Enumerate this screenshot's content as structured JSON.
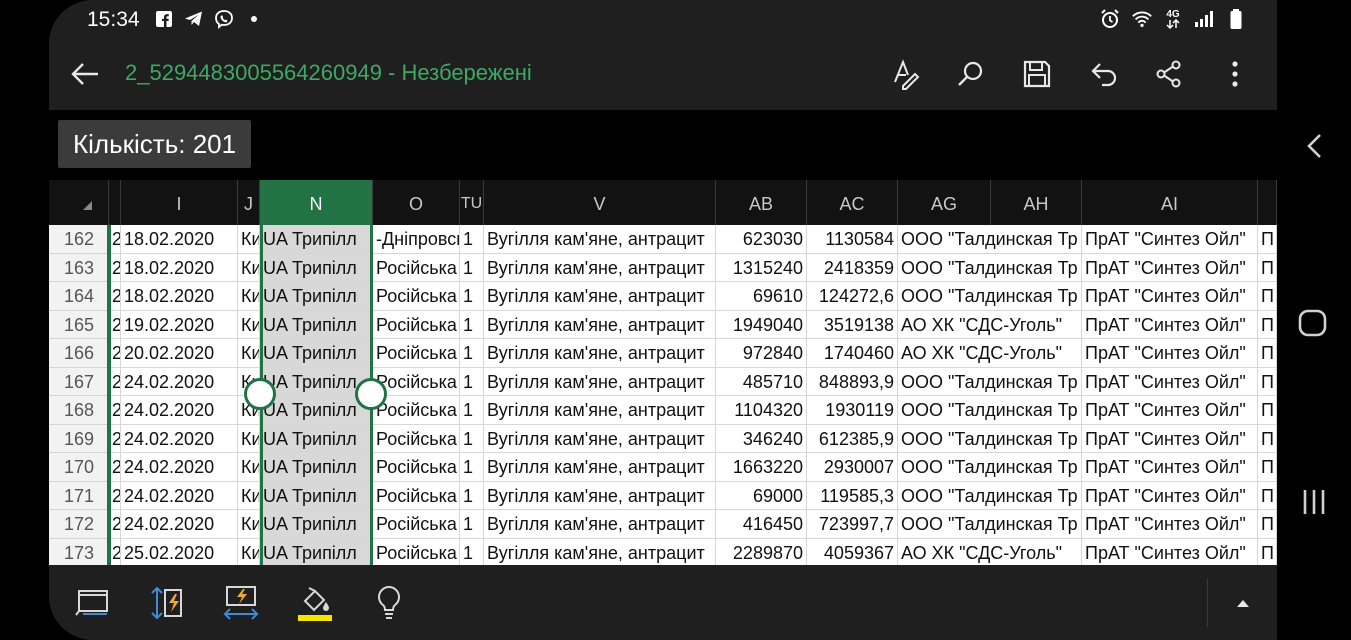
{
  "status_bar": {
    "time": "15:34",
    "icons": [
      "facebook-icon",
      "telegram-icon",
      "viber-icon",
      "notification-dot",
      "alarm-icon",
      "wifi-icon",
      "mobile-data-icon",
      "signal-icon",
      "battery-icon"
    ],
    "network_label": "4G"
  },
  "app_bar": {
    "title": "2_5294483005564260949 - Незбережені",
    "title_color": "#3fa862",
    "actions": [
      "draw-icon",
      "search-icon",
      "save-icon",
      "undo-icon",
      "share-icon",
      "more-icon"
    ]
  },
  "selection": {
    "count_label": "Кількість: 201",
    "selected_column": "N"
  },
  "columns": [
    "I",
    "J",
    "N",
    "O",
    "TU",
    "V",
    "AB",
    "AC",
    "AG",
    "AH",
    "AI"
  ],
  "rows": [
    {
      "n": "162",
      "h": "2",
      "i": "18.02.2020",
      "j": "Ки",
      "nval": "UA Трипілл",
      "o": "-Дніпровсь",
      "tu": "1",
      "v": "Вугілля кам'яне, антрацит",
      "ab": "623030",
      "ac": "1130584",
      "ag": "ООО \"Талдинская Тр",
      "ai": "ПрАТ \"Синтез Ойл\"",
      "last": "П"
    },
    {
      "n": "163",
      "h": "2",
      "i": "18.02.2020",
      "j": "Ки",
      "nval": "UA Трипілл",
      "o": "Російська Ф",
      "tu": "1",
      "v": "Вугілля кам'яне, антрацит",
      "ab": "1315240",
      "ac": "2418359",
      "ag": "ООО \"Талдинская Тр",
      "ai": "ПрАТ \"Синтез Ойл\"",
      "last": "П"
    },
    {
      "n": "164",
      "h": "2",
      "i": "18.02.2020",
      "j": "Ки",
      "nval": "UA Трипілл",
      "o": "Російська Ф",
      "tu": "1",
      "v": "Вугілля кам'яне, антрацит",
      "ab": "69610",
      "ac": "124272,6",
      "ag": "ООО \"Талдинская Тр",
      "ai": "ПрАТ \"Синтез Ойл\"",
      "last": "П"
    },
    {
      "n": "165",
      "h": "2",
      "i": "19.02.2020",
      "j": "Ки",
      "nval": "UA Трипілл",
      "o": "Російська Ф",
      "tu": "1",
      "v": "Вугілля кам'яне, антрацит",
      "ab": "1949040",
      "ac": "3519138",
      "ag": "АО ХК \"СДС-Уголь\"",
      "ai": "ПрАТ \"Синтез Ойл\"",
      "last": "П"
    },
    {
      "n": "166",
      "h": "2",
      "i": "20.02.2020",
      "j": "Ки",
      "nval": "UA Трипілл",
      "o": "Російська Ф",
      "tu": "1",
      "v": "Вугілля кам'яне, антрацит",
      "ab": "972840",
      "ac": "1740460",
      "ag": "АО ХК \"СДС-Уголь\"",
      "ai": "ПрАТ \"Синтез Ойл\"",
      "last": "П"
    },
    {
      "n": "167",
      "h": "2",
      "i": "24.02.2020",
      "j": "Ки",
      "nval": "UA Трипілл",
      "o": "Російська Ф",
      "tu": "1",
      "v": "Вугілля кам'яне, антрацит",
      "ab": "485710",
      "ac": "848893,9",
      "ag": "ООО \"Талдинская Тр",
      "ai": "ПрАТ \"Синтез Ойл\"",
      "last": "П"
    },
    {
      "n": "168",
      "h": "2",
      "i": "24.02.2020",
      "j": "Ки",
      "nval": "UA Трипілл",
      "o": "Російська Ф",
      "tu": "1",
      "v": "Вугілля кам'яне, антрацит",
      "ab": "1104320",
      "ac": "1930119",
      "ag": "ООО \"Талдинская Тр",
      "ai": "ПрАТ \"Синтез Ойл\"",
      "last": "П"
    },
    {
      "n": "169",
      "h": "2",
      "i": "24.02.2020",
      "j": "Ки",
      "nval": "UA Трипілл",
      "o": "Російська Ф",
      "tu": "1",
      "v": "Вугілля кам'яне, антрацит",
      "ab": "346240",
      "ac": "612385,9",
      "ag": "ООО \"Талдинская Тр",
      "ai": "ПрАТ \"Синтез Ойл\"",
      "last": "П"
    },
    {
      "n": "170",
      "h": "2",
      "i": "24.02.2020",
      "j": "Ки",
      "nval": "UA Трипілл",
      "o": "Російська Ф",
      "tu": "1",
      "v": "Вугілля кам'яне, антрацит",
      "ab": "1663220",
      "ac": "2930007",
      "ag": "ООО \"Талдинская Тр",
      "ai": "ПрАТ \"Синтез Ойл\"",
      "last": "П"
    },
    {
      "n": "171",
      "h": "2",
      "i": "24.02.2020",
      "j": "Ки",
      "nval": "UA Трипілл",
      "o": "Російська Ф",
      "tu": "1",
      "v": "Вугілля кам'яне, антрацит",
      "ab": "69000",
      "ac": "119585,3",
      "ag": "ООО \"Талдинская Тр",
      "ai": "ПрАТ \"Синтез Ойл\"",
      "last": "П"
    },
    {
      "n": "172",
      "h": "2",
      "i": "24.02.2020",
      "j": "Ки",
      "nval": "UA Трипілл",
      "o": "Російська Ф",
      "tu": "1",
      "v": "Вугілля кам'яне, антрацит",
      "ab": "416450",
      "ac": "723997,7",
      "ag": "ООО \"Талдинская Тр",
      "ai": "ПрАТ \"Синтез Ойл\"",
      "last": "П"
    },
    {
      "n": "173",
      "h": "2",
      "i": "25.02.2020",
      "j": "Ки",
      "nval": "UA Трипілл",
      "o": "Російська Ф",
      "tu": "1",
      "v": "Вугілля кам'яне, антрацит",
      "ab": "2289870",
      "ac": "4059367",
      "ag": "АО ХК \"СДС-Уголь\"",
      "ai": "ПрАТ \"Синтез Ойл\"",
      "last": "П"
    }
  ],
  "bottom_bar": {
    "actions": [
      "freeze-panes-icon",
      "autofit-row-icon",
      "autofit-column-icon",
      "fill-color-icon",
      "tell-me-icon",
      "expand-caret-icon"
    ],
    "fill_color": "#f5e400"
  },
  "nav_buttons": [
    "back-nav-icon",
    "home-nav-icon",
    "recents-nav-icon"
  ],
  "accent_color": "#217346"
}
